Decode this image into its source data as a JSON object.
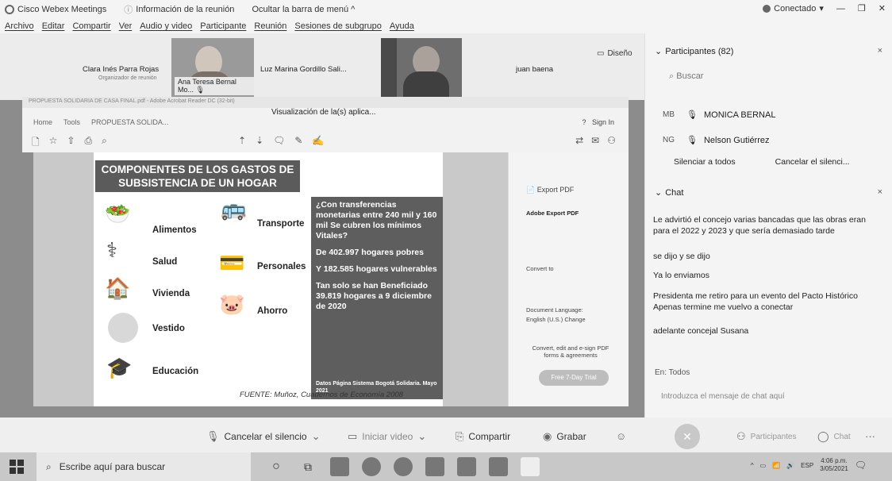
{
  "titlebar": {
    "app_name": "Cisco Webex Meetings",
    "info_label": "Información de la reunión",
    "hide_menu": "Ocultar la barra de menú ^",
    "status": "Conectado",
    "status_caret": "▾"
  },
  "menubar": [
    "Archivo",
    "Editar",
    "Compartir",
    "Ver",
    "Audio y video",
    "Participante",
    "Reunión",
    "Sesiones de subgrupo",
    "Ayuda"
  ],
  "video": {
    "host_name": "Clara Inés Parra Rojas",
    "host_role": "Organizador de reunión",
    "tile1_label": "Ana Teresa Bernal Mo...",
    "name2": "Luz Marina Gordillo Sali...",
    "name3": "juan baena",
    "layout_label": "Diseño"
  },
  "share": {
    "window_title": "PROPUESTA SOLIDARIA DE CASA FINAL.pdf - Adobe Acrobat Reader DC (32-bit)",
    "view_label": "Visualización de la(s) aplica...",
    "nav": [
      "Home",
      "Tools",
      "PROPUESTA SOLIDA..."
    ],
    "sign_in": "Sign In"
  },
  "slide": {
    "title": "COMPONENTES DE LOS GASTOS DE SUBSISTENCIA DE UN HOGAR",
    "left_items": [
      "Alimentos",
      "Salud",
      "Vivienda",
      "Vestido",
      "Educación"
    ],
    "right_items": [
      "Transporte",
      "Personales",
      "Ahorro"
    ],
    "box": {
      "q": "¿Con transferencias monetarias entre 240 mil y 160 mil Se cubren los mínimos Vitales?",
      "s1": "De 402.997 hogares pobres",
      "s2": "Y 182.585 hogares vulnerables",
      "s3": "Tan solo se han Beneficiado 39.819 hogares a 9 diciembre de 2020",
      "source": "Datos Página Sistema Bogotá Solidaria. Mayo 2021"
    },
    "fuente": "FUENTE: Muñoz, Cuadernos de Economía 2008"
  },
  "acrobat_panel": {
    "export_title": "Export PDF",
    "adobe_export": "Adobe Export PDF",
    "convert_to": "Convert to",
    "doc_language": "Document Language:",
    "language_value": "English (U.S.) Change",
    "promo": "Convert, edit and e-sign PDF forms & agreements",
    "trial_button": "Free 7-Day Trial"
  },
  "participants": {
    "header": "Participantes (82)",
    "search_placeholder": "Buscar",
    "list": [
      {
        "initials": "MB",
        "name": "MONICA BERNAL"
      },
      {
        "initials": "NG",
        "name": "Nelson Gutiérrez"
      }
    ],
    "mute_all": "Silenciar a todos",
    "unmute_all": "Cancelar el silenci..."
  },
  "chat": {
    "header": "Chat",
    "messages": [
      {
        "text": "Le advirtió el concejo varias bancadas que las obras eran para el 2022 y 2023 y que sería demasiado tarde"
      },
      {
        "text": "se dijo y se dijo"
      },
      {
        "text": "Ya lo enviamos"
      },
      {
        "text": "Presidenta me retiro para un evento del Pacto Histórico Apenas termine me vuelvo a conectar"
      },
      {
        "text": "adelante concejal Susana"
      }
    ],
    "to_label": "En: Todos",
    "input_placeholder": "Introduzca el mensaje de chat aquí"
  },
  "controls": {
    "mute": "Cancelar el silencio",
    "video": "Iniciar video",
    "share": "Compartir",
    "record": "Grabar",
    "participants": "Participantes",
    "chat": "Chat"
  },
  "taskbar": {
    "search_placeholder": "Escribe aquí para buscar",
    "lang": "ESP",
    "time": "4:06 p.m.",
    "date": "3/05/2021"
  }
}
